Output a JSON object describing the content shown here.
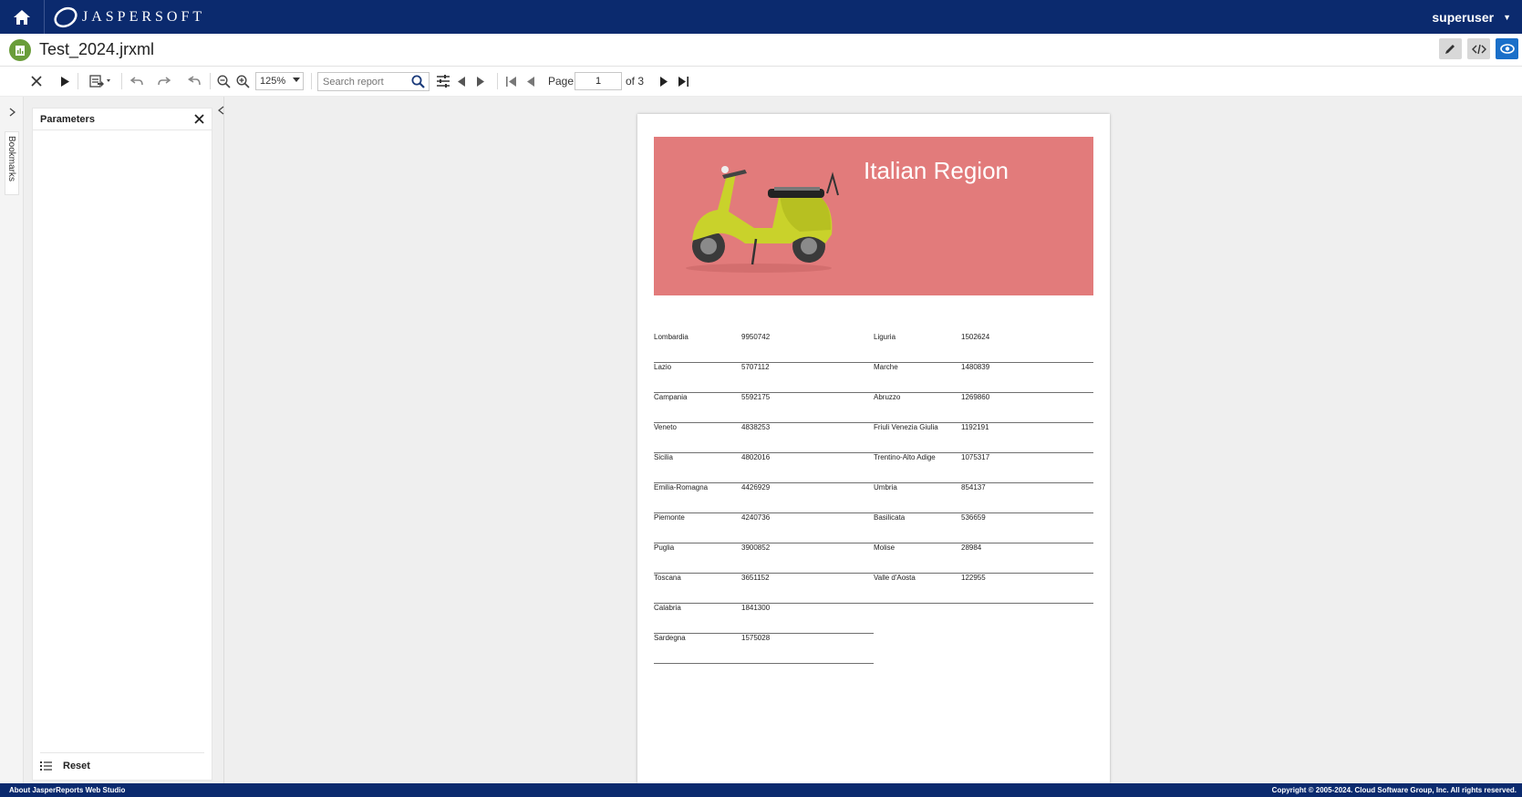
{
  "header": {
    "brand": "JASPERSOFT",
    "user": "superuser"
  },
  "file": {
    "title": "Test_2024.jrxml"
  },
  "toolbar": {
    "zoom": "125%",
    "search_placeholder": "Search report",
    "page_label": "Page",
    "page_value": "1",
    "of_label": "of  3"
  },
  "sidebar": {
    "bookmarks_label": "Bookmarks",
    "parameters_title": "Parameters",
    "reset_label": "Reset"
  },
  "report": {
    "title": "Italian Region",
    "banner_color": "#e27b7b",
    "left_column": [
      {
        "name": "Lombardia",
        "value": "9950742"
      },
      {
        "name": "Lazio",
        "value": "5707112"
      },
      {
        "name": "Campania",
        "value": "5592175"
      },
      {
        "name": "Veneto",
        "value": "4838253"
      },
      {
        "name": "Sicilia",
        "value": "4802016"
      },
      {
        "name": "Emilia-Romagna",
        "value": "4426929"
      },
      {
        "name": "Piemonte",
        "value": "4240736"
      },
      {
        "name": "Puglia",
        "value": "3900852"
      },
      {
        "name": "Toscana",
        "value": "3651152"
      },
      {
        "name": "Calabria",
        "value": "1841300"
      },
      {
        "name": "Sardegna",
        "value": "1575028"
      }
    ],
    "right_column": [
      {
        "name": "Liguria",
        "value": "1502624"
      },
      {
        "name": "Marche",
        "value": "1480839"
      },
      {
        "name": "Abruzzo",
        "value": "1269860"
      },
      {
        "name": "Friuli Venezia Giulia",
        "value": "1192191"
      },
      {
        "name": "Trentino-Alto Adige",
        "value": "1075317"
      },
      {
        "name": "Umbria",
        "value": "854137"
      },
      {
        "name": "Basilicata",
        "value": "536659"
      },
      {
        "name": "Molise",
        "value": "28984"
      },
      {
        "name": "Valle d'Aosta",
        "value": "122955"
      }
    ]
  },
  "statusbar": {
    "left": "About JasperReports Web Studio",
    "right": "Copyright © 2005-2024. Cloud Software Group, Inc. All rights reserved."
  },
  "colors": {
    "topbar": "#0b2a6e",
    "accent": "#1a6fc9"
  }
}
